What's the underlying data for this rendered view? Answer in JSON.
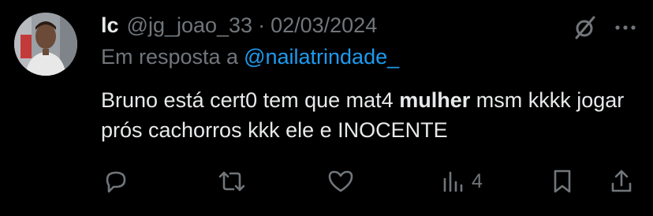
{
  "tweet": {
    "display_name": "lc",
    "handle": "@jg_joao_33",
    "separator": "·",
    "date": "02/03/2024",
    "reply_prefix": "Em resposta a",
    "reply_mention": "@nailatrindade_",
    "text_part1": "Bruno está cert0 tem que mat4 ",
    "text_bold": "mulher",
    "text_part2": " msm kkkk jogar prós cachorros kkk ele e INOCENTE",
    "views_count": "4"
  },
  "icons": {
    "header": [
      "grok-slash-icon",
      "more-options-icon"
    ],
    "actions": [
      "reply-icon",
      "retweet-icon",
      "like-icon",
      "views-icon",
      "bookmark-icon",
      "share-icon"
    ]
  },
  "colors": {
    "background": "#000000",
    "primary_text": "#e7e9ea",
    "secondary_text": "#71767b",
    "link": "#1d9bf0"
  }
}
